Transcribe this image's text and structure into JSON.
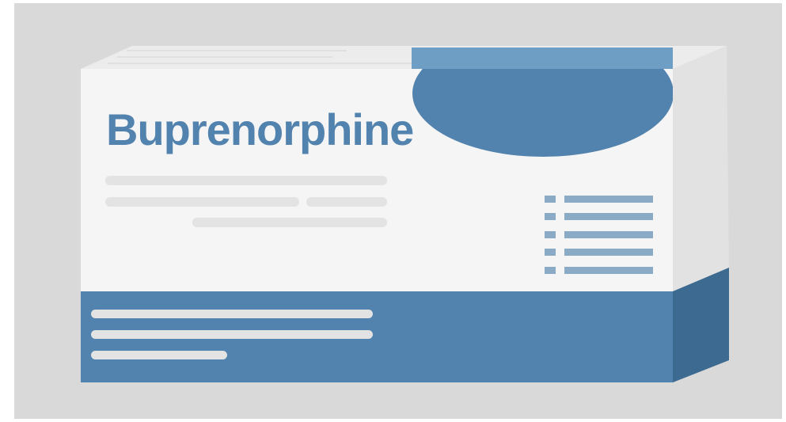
{
  "product": {
    "name": "Buprenorphine"
  },
  "colors": {
    "background": "#d9d9d9",
    "box_front": "#f5f5f5",
    "box_side": "#e2e2e2",
    "box_top": "#ececec",
    "brand_blue": "#5283ae",
    "brand_blue_light": "#6f9ec5",
    "brand_blue_dark": "#3d6a91",
    "placeholder_gray": "#e3e3e3",
    "list_blue": "#8aaac6"
  }
}
